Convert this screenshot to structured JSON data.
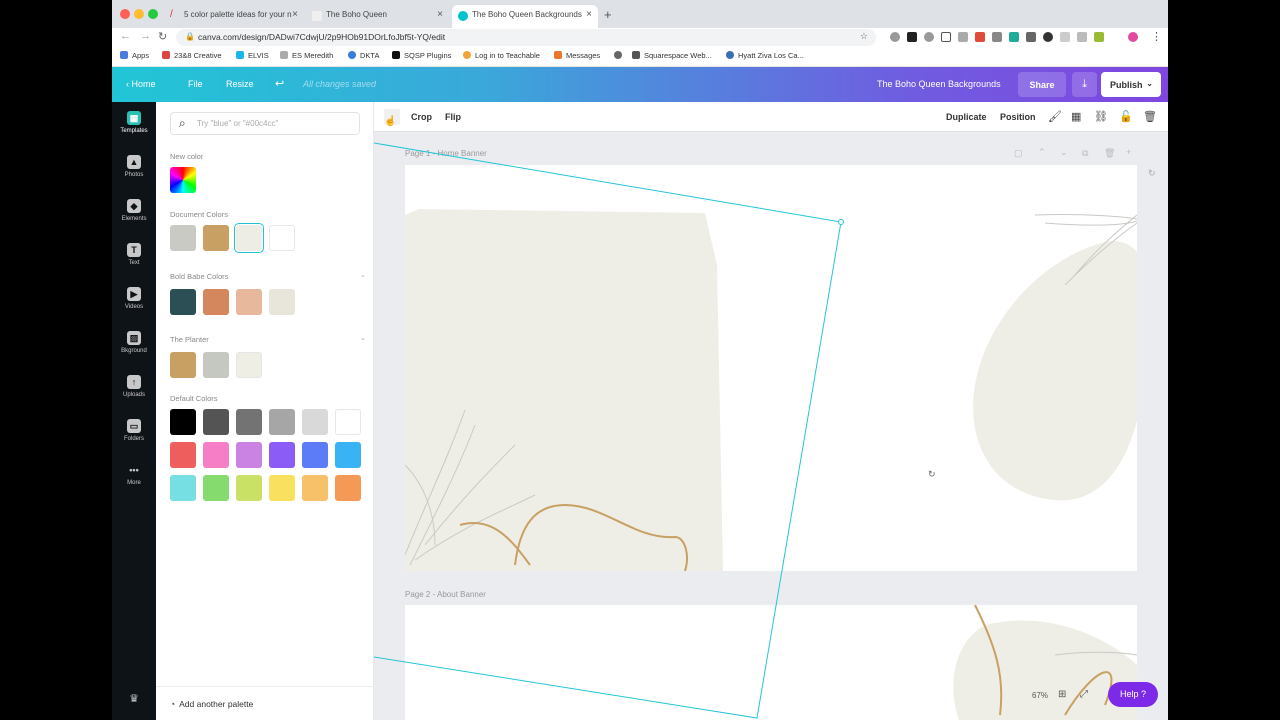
{
  "browser": {
    "tabs": [
      {
        "title": "5 color palette ideas for your n",
        "active": false
      },
      {
        "title": "The Boho Queen",
        "active": false
      },
      {
        "title": "The Boho Queen Backgrounds",
        "active": true
      }
    ],
    "new_tab_symbol": "+",
    "url": "canva.com/design/DADwi7CdwjU/2p9HOb91DOrLfoJbf5t-YQ/edit",
    "bookmarks": [
      "Apps",
      "23&8 Creative",
      "ELVIS",
      "ES Meredith",
      "DKTA",
      "SQSP Plugins",
      "Log in to Teachable",
      "Messages",
      "Squarespace Web...",
      "Hyatt Ziva Los Ca..."
    ]
  },
  "topbar": {
    "home": "Home",
    "file": "File",
    "resize": "Resize",
    "status": "All changes saved",
    "design_title": "The Boho Queen Backgrounds",
    "share": "Share",
    "publish": "Publish",
    "accent_gradient": [
      "#21c6d6",
      "#7f46e1"
    ]
  },
  "rail": [
    {
      "label": "Templates",
      "icon": "templates-icon",
      "active": true
    },
    {
      "label": "Photos",
      "icon": "photos-icon",
      "active": false
    },
    {
      "label": "Elements",
      "icon": "elements-icon",
      "active": false
    },
    {
      "label": "Text",
      "icon": "text-icon",
      "active": false
    },
    {
      "label": "Videos",
      "icon": "videos-icon",
      "active": false
    },
    {
      "label": "Bkground",
      "icon": "background-icon",
      "active": false
    },
    {
      "label": "Uploads",
      "icon": "uploads-icon",
      "active": false
    },
    {
      "label": "Folders",
      "icon": "folders-icon",
      "active": false
    },
    {
      "label": "More",
      "icon": "more-icon",
      "active": false
    }
  ],
  "panel": {
    "search_placeholder": "Try \"blue\" or \"#00c4cc\"",
    "new_color": "New color",
    "document_colors_title": "Document Colors",
    "document_colors": [
      "#c9cac4",
      "#c9a063",
      "#eeede5",
      "#ffffff"
    ],
    "palette1_title": "Bold Babe Colors",
    "palette1": [
      "#2c4f55",
      "#d4865d",
      "#e8b89c",
      "#e8e6da"
    ],
    "palette2_title": "The Planter",
    "palette2": [
      "#c9a063",
      "#c5c7c1",
      "#efeee5"
    ],
    "default_colors_title": "Default Colors",
    "default_colors": [
      [
        "#000000",
        "#545454",
        "#737373",
        "#a6a6a6",
        "#d9d9d9",
        "#ffffff"
      ],
      [
        "#ee5e5c",
        "#f57ec7",
        "#cb83e3",
        "#8c5cf6",
        "#5b7cf6",
        "#3ab3f5"
      ],
      [
        "#76dfe3",
        "#86db6e",
        "#c9e266",
        "#f9e05f",
        "#f7c16a",
        "#f59a56"
      ]
    ],
    "add_palette": "Add another palette"
  },
  "editor": {
    "toolbar": {
      "crop": "Crop",
      "flip": "Flip",
      "duplicate": "Duplicate",
      "position": "Position"
    },
    "page1_label": "Page 1 - Home Banner",
    "page2_label": "Page 2 - About Banner",
    "zoom": "67%",
    "help": "Help",
    "help_symbol": "?"
  }
}
